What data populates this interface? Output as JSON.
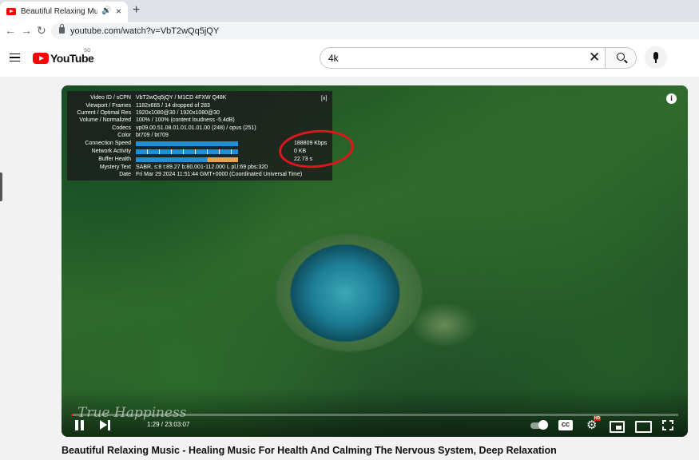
{
  "browser": {
    "tab_title": "Beautiful Relaxing Music - Heal",
    "url": "youtube.com/watch?v=VbT2wQq5jQY",
    "new_tab_symbol": "+",
    "close_symbol": "×",
    "audio_symbol": "🔊",
    "back_symbol": "←",
    "forward_symbol": "→",
    "reload_symbol": "↻"
  },
  "youtube": {
    "logo_text": "YouTube",
    "country_code": "SG",
    "search_query": "4k",
    "clear_symbol": "✕"
  },
  "stats_for_nerds": {
    "close_label": "[x]",
    "rows": [
      {
        "key": "Video ID / sCPN",
        "value": "VbT2wQq5jQY / M1CD 4FXW Q48K"
      },
      {
        "key": "Viewport / Frames",
        "value": "1182x665 / 14 dropped of 283"
      },
      {
        "key": "Current / Optimal Res",
        "value": "1920x1080@30 / 1920x1080@30"
      },
      {
        "key": "Volume / Normalized",
        "value": "100% / 100% (content loudness -5.4dB)"
      },
      {
        "key": "Codecs",
        "value": "vp09.00.51.08.01.01.01.01.00 (248) / opus (251)"
      },
      {
        "key": "Color",
        "value": "bt709 / bt709"
      },
      {
        "key": "Connection Speed",
        "value": "188809 Kbps"
      },
      {
        "key": "Network Activity",
        "value": "0 KB"
      },
      {
        "key": "Buffer Health",
        "value": "22.73 s"
      },
      {
        "key": "Mystery Text",
        "value": "SABR, s:8 t:89.27 b:80.001-112.000 L pl,l:69 pbs:320"
      },
      {
        "key": "Date",
        "value": "Fri Mar 29 2024 11:51:44 GMT+0000 (Coordinated Universal Time)"
      }
    ],
    "colors": {
      "bar_blue": "#1f8fd6",
      "bar_orange": "#e4a447",
      "marker_red": "#e0151b"
    }
  },
  "player": {
    "watermark": "True Happiness",
    "current_time": "1:29",
    "duration": "23:03:07",
    "time_separator": " / ",
    "progress_fraction": 0.001,
    "cc_label": "CC",
    "hd_badge": "HD",
    "gear_symbol": "⚙",
    "info_symbol": "i"
  },
  "video": {
    "title": "Beautiful Relaxing Music - Healing Music For Health And Calming The Nervous System, Deep Relaxation"
  }
}
